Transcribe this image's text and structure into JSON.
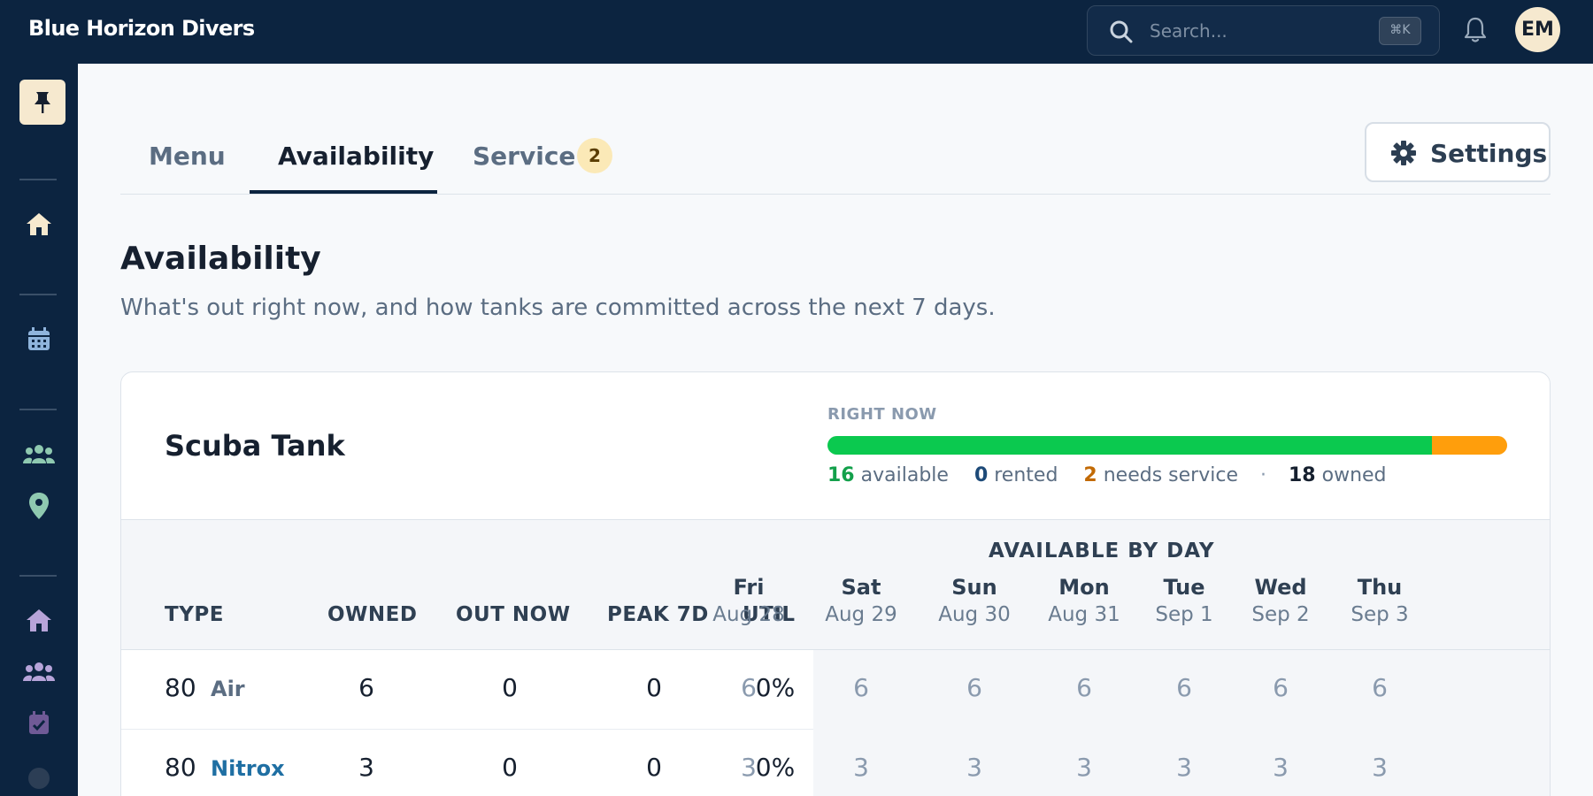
{
  "app": {
    "brand": "Blue Horizon Divers"
  },
  "search": {
    "placeholder": "Search...",
    "shortcut": "⌘K"
  },
  "user": {
    "initials": "EM"
  },
  "tabs": [
    {
      "label": "Menu",
      "active": false
    },
    {
      "label": "Availability",
      "active": true
    },
    {
      "label": "Service",
      "active": false,
      "badge": "2"
    }
  ],
  "settings_label": "Settings",
  "page": {
    "title": "Availability",
    "subtitle": "What's out right now, and how tanks are committed across the next 7 days."
  },
  "card": {
    "title": "Scuba Tank",
    "right_now_label": "RIGHT NOW",
    "right_now": {
      "available": "16",
      "available_label": "available",
      "rented": "0",
      "rented_label": "rented",
      "needs_service": "2",
      "needs_service_label": "needs service",
      "owned": "18",
      "owned_label": "owned",
      "available_color": "#0bc94f",
      "needs_service_color": "#ff9e0c"
    },
    "columns": {
      "type": "TYPE",
      "owned": "OWNED",
      "out_now": "OUT NOW",
      "peak": "PEAK 7D",
      "util": "UTIL",
      "available_by_day": "AVAILABLE BY DAY"
    },
    "days": [
      {
        "name": "Fri",
        "date": "Aug 28"
      },
      {
        "name": "Sat",
        "date": "Aug 29"
      },
      {
        "name": "Sun",
        "date": "Aug 30"
      },
      {
        "name": "Mon",
        "date": "Aug 31"
      },
      {
        "name": "Tue",
        "date": "Sep 1"
      },
      {
        "name": "Wed",
        "date": "Sep 2"
      },
      {
        "name": "Thu",
        "date": "Sep 3"
      }
    ],
    "rows": [
      {
        "size": "80",
        "gas": "Air",
        "gas_color": "#5b6d82",
        "owned": "6",
        "out_now": "0",
        "peak": "0",
        "util": "0%",
        "by_day": [
          "6",
          "6",
          "6",
          "6",
          "6",
          "6",
          "6"
        ]
      },
      {
        "size": "80",
        "gas": "Nitrox",
        "gas_color": "#1f6fa3",
        "owned": "3",
        "out_now": "0",
        "peak": "0",
        "util": "0%",
        "by_day": [
          "3",
          "3",
          "3",
          "3",
          "3",
          "3",
          "3"
        ]
      }
    ]
  }
}
